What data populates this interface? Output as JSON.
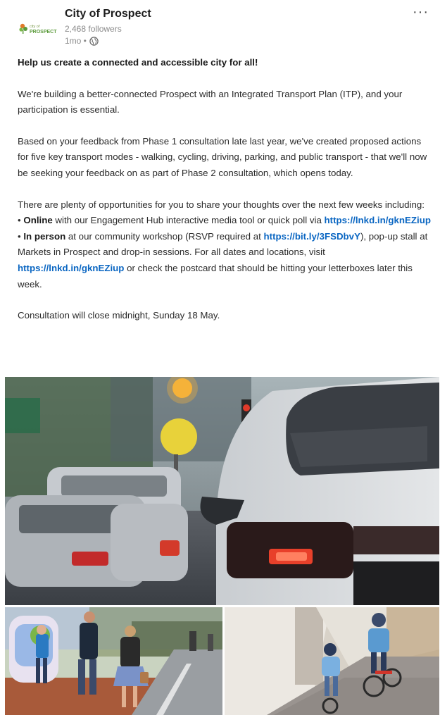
{
  "post": {
    "org_name": "City of Prospect",
    "logo_text": "PROSPECT",
    "followers": "2,468 followers",
    "time": "1mo •",
    "heading": "Help us create a connected and accessible city for all!",
    "p1": "We're building a better-connected Prospect with an Integrated Transport Plan (ITP), and your participation is essential.",
    "p2": "Based on your feedback from Phase 1 consultation late last year, we've created proposed actions for five key transport modes - walking, cycling, driving, parking, and public transport - that we'll now be seeking your feedback on as part of Phase 2 consultation, which opens today.",
    "p3": "There are plenty of opportunities for you to share your thoughts over the next few weeks including:",
    "online_bullet": "• ",
    "online_label": "Online",
    "online_text": " with our Engagement Hub interactive media tool or quick poll via ",
    "online_link": "https://lnkd.in/gknEZiup",
    "inperson_bullet": "• ",
    "inperson_label": "In person",
    "inperson_text1": " at our community workshop (RSVP required at ",
    "inperson_link1": "https://bit.ly/3FSDbvY",
    "inperson_text2": "), pop-up stall at Markets in Prospect and drop-in sessions. For all dates and locations, visit ",
    "inperson_link2": "https://lnkd.in/gknEZiup",
    "inperson_text3": " or check the postcard that should be hitting your letterboxes later this week.",
    "closing": "Consultation will close midnight, Sunday 18 May."
  },
  "icons": {
    "more": "more-options-icon",
    "globe": "globe-icon"
  },
  "colors": {
    "link": "#0a66c2",
    "muted": "#8a8a8a",
    "logo_green": "#5a9a3a",
    "logo_orange": "#e07a2a"
  }
}
